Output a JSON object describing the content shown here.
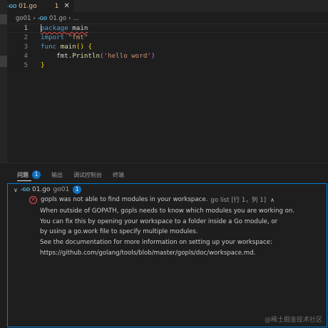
{
  "tab": {
    "icon": "go-file-icon",
    "icon_text": "-GO",
    "filename": "01.go",
    "problem_count": "1",
    "close_glyph": "✕"
  },
  "breadcrumb": {
    "folder": "go01",
    "sep1": "›",
    "icon_text": "-GO",
    "file": "01.go",
    "sep2": "›",
    "rest": "..."
  },
  "editor": {
    "line_numbers": [
      "1",
      "2",
      "3",
      "4",
      "5"
    ],
    "lines": [
      {
        "kw": "package",
        "rest": " main"
      },
      {
        "kw": "import",
        "str": "\"fmt\""
      },
      {
        "kw": "func",
        "fn": "main",
        "paren": "() ",
        "brace": "{"
      },
      {
        "pre": "    fmt.",
        "fn": "Println",
        "open": "(",
        "str": "'hello word'",
        "close": ")"
      },
      {
        "brace": "}"
      }
    ]
  },
  "panel": {
    "tabs": [
      {
        "label": "问题",
        "badge": "1"
      },
      {
        "label": "输出"
      },
      {
        "label": "调试控制台"
      },
      {
        "label": "终端"
      }
    ],
    "file_group": {
      "icon_text": "-GO",
      "filename": "01.go",
      "dir": "go01",
      "count": "1"
    },
    "error": {
      "message": "gopls was not able to find modules in your workspace.",
      "source": "go list [行 1，列 1]"
    },
    "details": [
      "When outside of GOPATH, gopls needs to know which modules you are working on.",
      "You can fix this by opening your workspace to a folder inside a Go module, or",
      "by using a go.work file to specify multiple modules.",
      "See the documentation for more information on setting up your workspace:",
      "https://github.com/golang/tools/blob/master/gopls/doc/workspace.md."
    ]
  },
  "watermark": "@稀土掘金技术社区",
  "colors": {
    "keyword": "#569cd6",
    "string": "#ce9178",
    "function": "#dcdcaa",
    "badge": "#0e70c0",
    "error": "#f14c4c",
    "modified_tab": "#e2c08d"
  }
}
